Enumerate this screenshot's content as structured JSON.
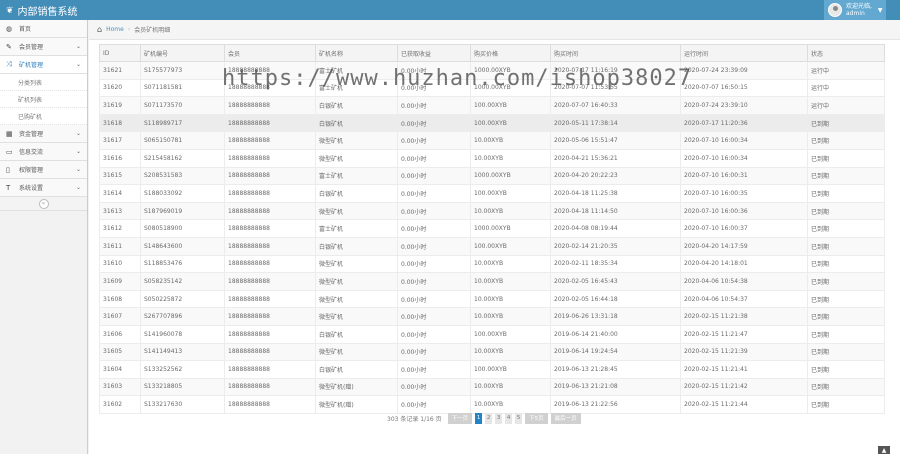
{
  "app": {
    "title": "内部销售系统",
    "leaf_icon": "leaf-icon"
  },
  "user": {
    "greeting": "欢迎光临,",
    "name": "admin"
  },
  "sidebar": {
    "items": [
      {
        "label": "首页",
        "icon": "dashboard-icon"
      },
      {
        "label": "会员管理",
        "icon": "edit-icon"
      },
      {
        "label": "矿机管理",
        "icon": "shuffle-icon"
      },
      {
        "label": "资金管理",
        "icon": "calendar-icon"
      },
      {
        "label": "信息交流",
        "icon": "chat-icon"
      },
      {
        "label": "权限管理",
        "icon": "file-icon"
      },
      {
        "label": "系统设置",
        "icon": "text-width-icon"
      }
    ],
    "sub_items": [
      {
        "label": "分类列表"
      },
      {
        "label": "矿机列表"
      },
      {
        "label": "已购矿机"
      }
    ],
    "collapse_icon": "«"
  },
  "breadcrumbs": {
    "home": "Home",
    "current": "会员矿机明细"
  },
  "table": {
    "headers": [
      "ID",
      "矿机编号",
      "会员",
      "矿机名称",
      "已获取收益",
      "购买价格",
      "购买时间",
      "运行时间",
      "状态"
    ],
    "rows": [
      [
        "31621",
        "S175577973",
        "18888888888",
        "富士矿机",
        "0.00小时",
        "1000.00XYB",
        "2020-07-17 11:16:19",
        "2020-07-24 23:39:09",
        "运行中"
      ],
      [
        "31620",
        "S071181581",
        "18888888888",
        "富士矿机",
        "0.00小时",
        "1000.00XYB",
        "2020-07-07 11:53:55",
        "2020-07-07 16:50:15",
        "运行中"
      ],
      [
        "31619",
        "S071173570",
        "18888888888",
        "白银矿机",
        "0.00小时",
        "100.00XYB",
        "2020-07-07 16:40:33",
        "2020-07-24 23:39:10",
        "运行中"
      ],
      [
        "31618",
        "S118989717",
        "18888888888",
        "白银矿机",
        "0.00小时",
        "100.00XYB",
        "2020-05-11 17:38:14",
        "2020-07-17 11:20:36",
        "已到期"
      ],
      [
        "31617",
        "S065150781",
        "18888888888",
        "微型矿机",
        "0.00小时",
        "10.00XYB",
        "2020-05-06 15:51:47",
        "2020-07-10 16:00:34",
        "已到期"
      ],
      [
        "31616",
        "S215458162",
        "18888888888",
        "微型矿机",
        "0.00小时",
        "10.00XYB",
        "2020-04-21 15:36:21",
        "2020-07-10 16:00:34",
        "已到期"
      ],
      [
        "31615",
        "S208531583",
        "18888888888",
        "富士矿机",
        "0.00小时",
        "1000.00XYB",
        "2020-04-20 20:22:23",
        "2020-07-10 16:00:31",
        "已到期"
      ],
      [
        "31614",
        "S188033092",
        "18888888888",
        "白银矿机",
        "0.00小时",
        "100.00XYB",
        "2020-04-18 11:25:38",
        "2020-07-10 16:00:35",
        "已到期"
      ],
      [
        "31613",
        "S187969019",
        "18888888888",
        "微型矿机",
        "0.00小时",
        "10.00XYB",
        "2020-04-18 11:14:50",
        "2020-07-10 16:00:36",
        "已到期"
      ],
      [
        "31612",
        "S080518900",
        "18888888888",
        "富士矿机",
        "0.00小时",
        "1000.00XYB",
        "2020-04-08 08:19:44",
        "2020-07-10 16:00:37",
        "已到期"
      ],
      [
        "31611",
        "S148643600",
        "18888888888",
        "白银矿机",
        "0.00小时",
        "100.00XYB",
        "2020-02-14 21:20:35",
        "2020-04-20 14:17:59",
        "已到期"
      ],
      [
        "31610",
        "S118853476",
        "18888888888",
        "微型矿机",
        "0.00小时",
        "10.00XYB",
        "2020-02-11 18:35:34",
        "2020-04-20 14:18:01",
        "已到期"
      ],
      [
        "31609",
        "S058235142",
        "18888888888",
        "微型矿机",
        "0.00小时",
        "10.00XYB",
        "2020-02-05 16:45:43",
        "2020-04-06 10:54:38",
        "已到期"
      ],
      [
        "31608",
        "S050225872",
        "18888888888",
        "微型矿机",
        "0.00小时",
        "10.00XYB",
        "2020-02-05 16:44:18",
        "2020-04-06 10:54:37",
        "已到期"
      ],
      [
        "31607",
        "S267707896",
        "18888888888",
        "微型矿机",
        "0.00小时",
        "10.00XYB",
        "2019-06-26 13:31:18",
        "2020-02-15 11:21:38",
        "已到期"
      ],
      [
        "31606",
        "S141960078",
        "18888888888",
        "白银矿机",
        "0.00小时",
        "100.00XYB",
        "2019-06-14 21:40:00",
        "2020-02-15 11:21:47",
        "已到期"
      ],
      [
        "31605",
        "S141149413",
        "18888888888",
        "微型矿机",
        "0.00小时",
        "10.00XYB",
        "2019-06-14 19:24:54",
        "2020-02-15 11:21:39",
        "已到期"
      ],
      [
        "31604",
        "S133252562",
        "18888888888",
        "白银矿机",
        "0.00小时",
        "100.00XYB",
        "2019-06-13 21:28:45",
        "2020-02-15 11:21:41",
        "已到期"
      ],
      [
        "31603",
        "S133218805",
        "18888888888",
        "微型矿机(赠)",
        "0.00小时",
        "10.00XYB",
        "2019-06-13 21:21:08",
        "2020-02-15 11:21:42",
        "已到期"
      ],
      [
        "31602",
        "S133217630",
        "18888888888",
        "微型矿机(赠)",
        "0.00小时",
        "10.00XYB",
        "2019-06-13 21:22:56",
        "2020-02-15 11:21:44",
        "已到期"
      ]
    ]
  },
  "pagination": {
    "info": "303 条记录 1/16 页",
    "prev": "下一页",
    "pages": [
      "1",
      "2",
      "3",
      "4",
      "5"
    ],
    "next": "下5页",
    "last": "最后一页"
  },
  "watermark": "https://www.huzhan.com/ishop38027",
  "colors": {
    "topbar": "#438eb9",
    "accent": "#2b7dbc",
    "current_page": "#2283c5"
  }
}
